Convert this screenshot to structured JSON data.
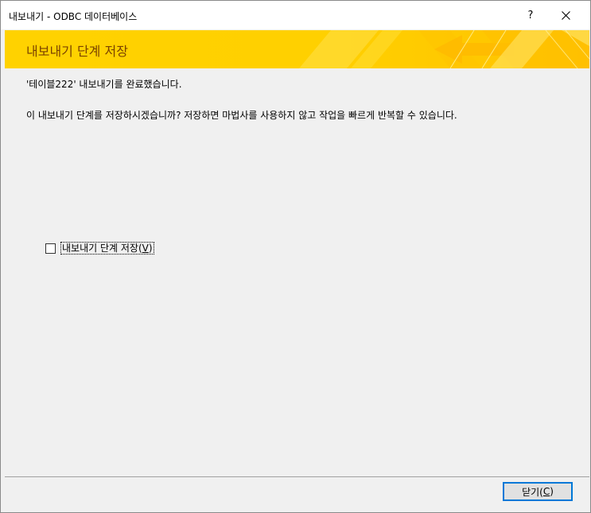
{
  "window": {
    "title": "내보내기 - ODBC 데이터베이스",
    "help_glyph": "?"
  },
  "banner": {
    "title": "내보내기 단계 저장"
  },
  "main": {
    "message_complete": "'테이블222' 내보내기를 완료했습니다.",
    "message_question": "이 내보내기 단계를 저장하시겠습니까? 저장하면 마법사를 사용하지 않고 작업을 빠르게 반복할 수 있습니다.",
    "save_steps_checkbox": {
      "label_text": "내보내기 단계 저장(",
      "accelerator": "V",
      "label_suffix": ")",
      "checked": false
    }
  },
  "footer": {
    "close_button": {
      "label_text": "닫기(",
      "accelerator": "C",
      "label_suffix": ")"
    }
  },
  "colors": {
    "banner_yellow": "#ffd200",
    "banner_title": "#7a4200",
    "focus_blue": "#0078d7"
  }
}
